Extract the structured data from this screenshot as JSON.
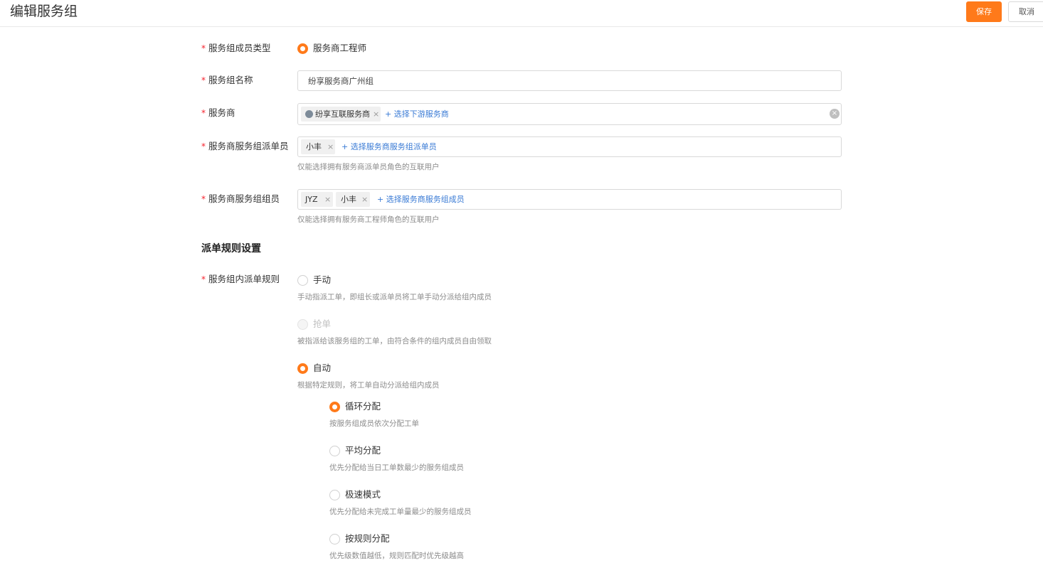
{
  "header": {
    "title": "编辑服务组",
    "save_label": "保存",
    "cancel_label": "取消"
  },
  "form": {
    "required_mark": "*",
    "member_type": {
      "label": "服务组成员类型",
      "option": "服务商工程师",
      "selected": true
    },
    "group_name": {
      "label": "服务组名称",
      "value": "纷享服务商广州组"
    },
    "provider": {
      "label": "服务商",
      "tags": [
        "纷享互联服务商"
      ],
      "add_link": "+ 选择下游服务商"
    },
    "dispatcher": {
      "label": "服务商服务组派单员",
      "tags": [
        "小丰"
      ],
      "add_link": "+ 选择服务商服务组派单员",
      "hint": "仅能选择拥有服务商派单员角色的互联用户"
    },
    "members": {
      "label": "服务商服务组组员",
      "tags": [
        "JYZ",
        "小丰"
      ],
      "add_link": "+ 选择服务商服务组成员",
      "hint": "仅能选择拥有服务商工程师角色的互联用户"
    }
  },
  "dispatch_rules": {
    "section_title": "派单规则设置",
    "label": "服务组内派单规则",
    "options": [
      {
        "label": "手动",
        "hint": "手动指派工单，即组长或派单员将工单手动分派给组内成员",
        "state": "unchecked"
      },
      {
        "label": "抢单",
        "hint": "被指派给该服务组的工单，由符合条件的组内成员自由领取",
        "state": "disabled"
      },
      {
        "label": "自动",
        "hint": "根据特定规则，将工单自动分派给组内成员",
        "state": "checked"
      }
    ],
    "auto_options": [
      {
        "label": "循环分配",
        "hint": "按服务组成员依次分配工单",
        "state": "checked"
      },
      {
        "label": "平均分配",
        "hint": "优先分配给当日工单数最少的服务组成员",
        "state": "unchecked"
      },
      {
        "label": "极速模式",
        "hint": "优先分配给未完成工单量最少的服务组成员",
        "state": "unchecked"
      },
      {
        "label": "按规则分配",
        "hint": "优先级数值越低，规则匹配时优先级越高",
        "state": "unchecked"
      }
    ]
  },
  "colors": {
    "accent": "#ff7a1a",
    "link": "#3a7bd5",
    "required": "#f5222d"
  }
}
